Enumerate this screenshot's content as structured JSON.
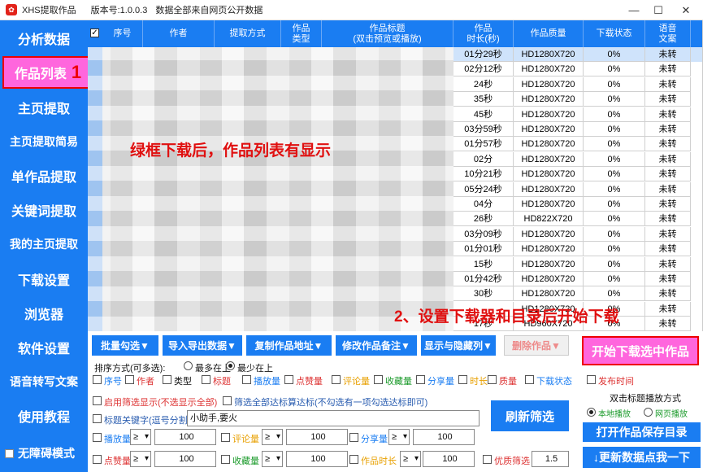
{
  "titlebar": {
    "app_name": "XHS提取作品",
    "version": "版本号:1.0.0.3",
    "notice": "数据全部来自网页公开数据"
  },
  "sidebar": {
    "items": [
      {
        "label": "分析数据"
      },
      {
        "label": "作品列表",
        "number": "1"
      },
      {
        "label": "主页提取"
      },
      {
        "label": "主页提取简易"
      },
      {
        "label": "单作品提取"
      },
      {
        "label": "关键词提取"
      },
      {
        "label": "我的主页提取"
      },
      {
        "label": "下载设置"
      },
      {
        "label": "浏览器"
      },
      {
        "label": "软件设置"
      },
      {
        "label": "语音转写文案"
      },
      {
        "label": "使用教程"
      }
    ],
    "accessible_mode": "无障碍模式"
  },
  "table": {
    "headers": [
      "序号",
      "作者",
      "提取方式",
      "作品\n类型",
      "作品标题\n(双击预览或播放)",
      "作品\n时长(秒)",
      "作品质量",
      "下载状态",
      "语音\n文案"
    ],
    "header_check": "✓",
    "rows": [
      {
        "duration": "01分29秒",
        "quality": "HD1280X720",
        "status": "0%",
        "voice": "未转"
      },
      {
        "duration": "02分12秒",
        "quality": "HD1280X720",
        "status": "0%",
        "voice": "未转"
      },
      {
        "duration": "24秒",
        "quality": "HD1280X720",
        "status": "0%",
        "voice": "未转"
      },
      {
        "duration": "35秒",
        "quality": "HD1280X720",
        "status": "0%",
        "voice": "未转"
      },
      {
        "duration": "45秒",
        "quality": "HD1280X720",
        "status": "0%",
        "voice": "未转"
      },
      {
        "duration": "03分59秒",
        "quality": "HD1280X720",
        "status": "0%",
        "voice": "未转"
      },
      {
        "duration": "01分57秒",
        "quality": "HD1280X720",
        "status": "0%",
        "voice": "未转"
      },
      {
        "duration": "02分",
        "quality": "HD1280X720",
        "status": "0%",
        "voice": "未转"
      },
      {
        "duration": "10分21秒",
        "quality": "HD1280X720",
        "status": "0%",
        "voice": "未转"
      },
      {
        "duration": "05分24秒",
        "quality": "HD1280X720",
        "status": "0%",
        "voice": "未转"
      },
      {
        "duration": "04分",
        "quality": "HD1280X720",
        "status": "0%",
        "voice": "未转"
      },
      {
        "duration": "26秒",
        "quality": "HD822X720",
        "status": "0%",
        "voice": "未转"
      },
      {
        "duration": "03分09秒",
        "quality": "HD1280X720",
        "status": "0%",
        "voice": "未转"
      },
      {
        "duration": "01分01秒",
        "quality": "HD1280X720",
        "status": "0%",
        "voice": "未转"
      },
      {
        "duration": "15秒",
        "quality": "HD1280X720",
        "status": "0%",
        "voice": "未转"
      },
      {
        "duration": "01分42秒",
        "quality": "HD1280X720",
        "status": "0%",
        "voice": "未转"
      },
      {
        "duration": "30秒",
        "quality": "HD1280X720",
        "status": "0%",
        "voice": "未转"
      },
      {
        "duration": "",
        "quality": "HD1280X720",
        "status": "0%",
        "voice": "未转"
      },
      {
        "duration": "17秒",
        "quality": "HD960X720",
        "status": "0%",
        "voice": "未转"
      }
    ]
  },
  "annotations": {
    "note1": "绿框下载后，作品列表有显示",
    "note2": "2、设置下载器和目录后开始下载"
  },
  "toolbar": {
    "buttons": [
      "批量勾选▼",
      "导入导出数据▼",
      "复制作品地址▼",
      "修改作品备注▼",
      "显示与隐藏列▼",
      "删除作品▼"
    ],
    "start": "开始下载选中作品"
  },
  "sort": {
    "label": "排序方式(可多选):",
    "most_top": "最多在上",
    "least_top": "最少在上",
    "fields": [
      "序号",
      "作者",
      "类型",
      "标题",
      "播放量",
      "点赞量",
      "评论量",
      "收藏量",
      "分享量",
      "时长",
      "质量",
      "下载状态",
      "发布时间"
    ]
  },
  "filters": {
    "enable": "启用筛选显示(不选显示全部)",
    "select_all": "筛选全部达标算达标(不勾选有一项勾选达标即可)",
    "title_keyword_label": "标题关键字(逗号分割):",
    "title_keyword_value": "小助手,要火",
    "refresh": "刷新筛选",
    "row1": [
      {
        "label": "播放量",
        "op": "≥",
        "value": "100"
      },
      {
        "label": "评论量",
        "op": "≥",
        "value": "100"
      },
      {
        "label": "分享量",
        "op": "≥",
        "value": "100"
      }
    ],
    "row2": [
      {
        "label": "点赞量",
        "op": "≥",
        "value": "100"
      },
      {
        "label": "收藏量",
        "op": "≥",
        "value": "100"
      },
      {
        "label": "作品时长",
        "op": "≥",
        "value": "100"
      }
    ],
    "quality_label": "优质筛选",
    "quality_value": "1.5"
  },
  "right_panel": {
    "play_mode_label": "双击标题播放方式",
    "local_play": "本地播放",
    "web_play": "网页播放",
    "open_dir": "打开作品保存目录",
    "update": "↓更新数据点我一下"
  },
  "colors": {
    "primary": "#1a7df2",
    "highlight": "#ff66dd",
    "annotation_red": "#e01010"
  }
}
